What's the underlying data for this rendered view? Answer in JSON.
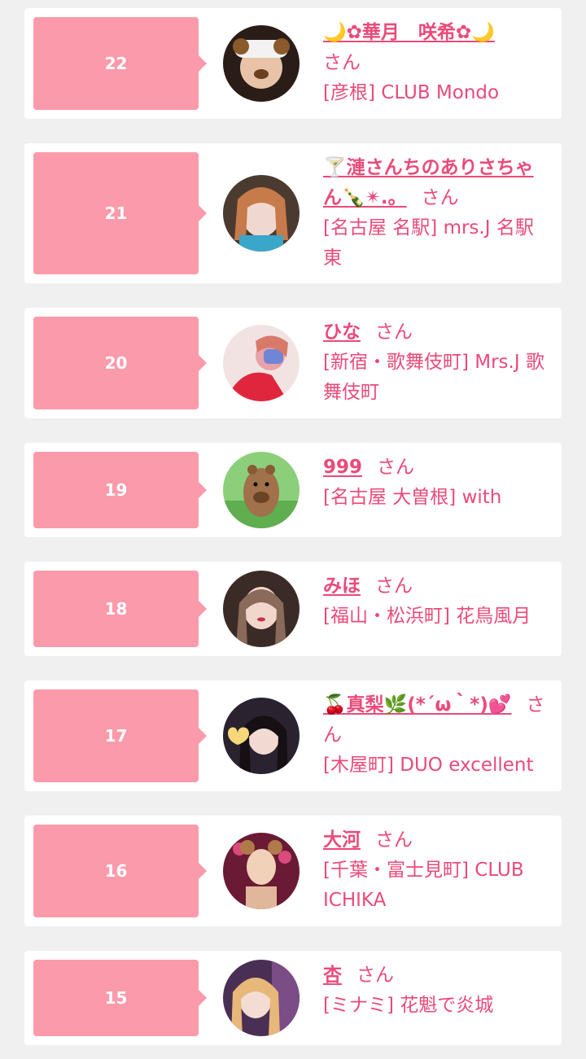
{
  "ranking": [
    {
      "rank": "22",
      "name": "🌙✿華月　咲希✿🌙",
      "suffix": "さん",
      "shop": "[彦根] CLUB Mondo"
    },
    {
      "rank": "21",
      "name": "🍸漣さんちのありさちゃん🍾✴︎.。",
      "suffix": "さん",
      "shop": "[名古屋 名駅] mrs.J 名駅東"
    },
    {
      "rank": "20",
      "name": "ひな",
      "suffix": "さん",
      "shop": "[新宿・歌舞伎町] Mrs.J 歌舞伎町"
    },
    {
      "rank": "19",
      "name": "999",
      "suffix": "さん",
      "shop": "[名古屋 大曽根] with"
    },
    {
      "rank": "18",
      "name": "みほ",
      "suffix": "さん",
      "shop": "[福山・松浜町] 花鳥風月"
    },
    {
      "rank": "17",
      "name": "🍒真梨🌿(*´ω｀*)💕",
      "suffix": "さん",
      "shop": "[木屋町] DUO excellent"
    },
    {
      "rank": "16",
      "name": "大河",
      "suffix": "さん",
      "shop": "[千葉・富士見町] CLUB ICHIKA"
    },
    {
      "rank": "15",
      "name": "杏",
      "suffix": "さん",
      "shop": "[ミナミ] 花魁で炎城"
    }
  ],
  "colors": {
    "accent": "#ea4a79",
    "rank_bg": "#fb9aaa",
    "page_bg": "#f0f0f0"
  }
}
